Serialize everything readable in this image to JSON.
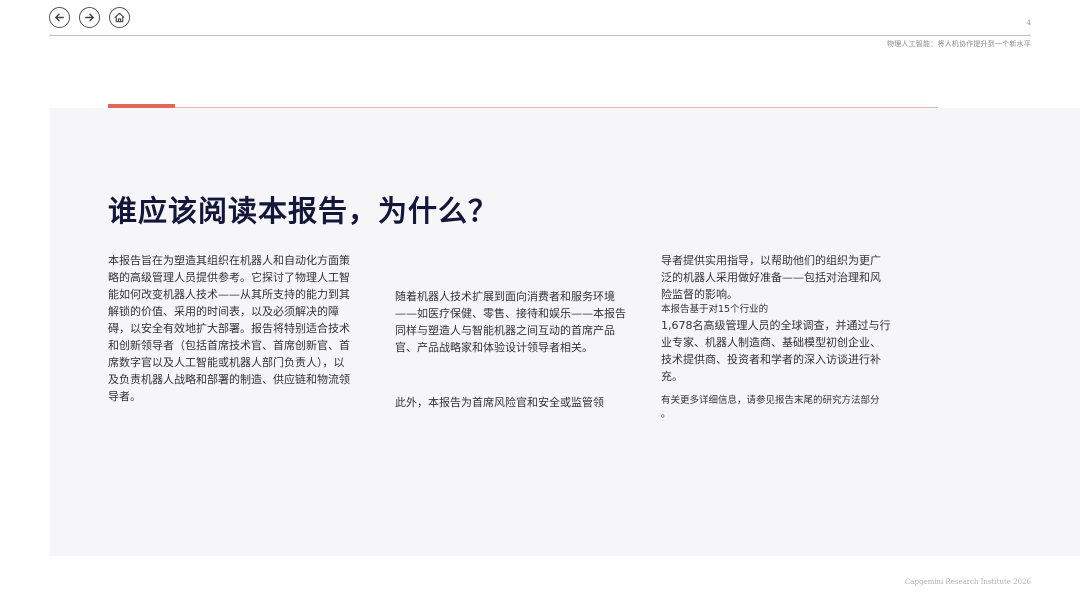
{
  "header": {
    "page_number": "4",
    "title": "物理人工智能：将人机协作提升到一个新水平"
  },
  "nav": {
    "icons": [
      "arrow-left-icon",
      "arrow-right-icon",
      "home-icon"
    ]
  },
  "main": {
    "headline": "谁应该阅读本报告，为什么？",
    "col1": "本报告旨在为塑造其组织在机器人和自动化方面策略的高级管理人员提供参考。它探讨了物理人工智能如何改变机器人技术——从其所支持的能力到其解锁的价值、采用的时间表，以及必须解决的障碍，以安全有效地扩大部署。报告将特别适合技术和创新领导者（包括首席技术官、首席创新官、首席数字官以及人工智能或机器人部门负责人），以及负责机器人战略和部署的制造、供应链和物流领导者。",
    "col2a": "随着机器人技术扩展到面向消费者和服务环境——如医疗保健、零售、接待和娱乐——本报告同样与塑造人与智能机器之间互动的首席产品官、产品战略家和体验设计领导者相关。",
    "col2b": "此外，本报告为首席风险官和安全或监管领",
    "col3_intro": "导者提供实用指导，以帮助他们的组织为更广泛的机器人采用做好准备——包括对治理和风险监督的影响。",
    "col3_small": "本报告基于对15个行业的",
    "col3_survey": "1,678名高级管理人员的全球调查，并通过与行业专家、机器人制造商、基础模型初创企业、技术提供商、投资者和学者的深入访谈进行补充。",
    "col3_note": "有关更多详细信息，请参见报告末尾的研究方法部分",
    "col3_note_end": "。"
  },
  "footer": {
    "source": "Capgemini Research Institute 2026"
  },
  "colors": {
    "accent": "#e4685a",
    "headline": "#14163a",
    "panel": "#f6f6f8"
  }
}
